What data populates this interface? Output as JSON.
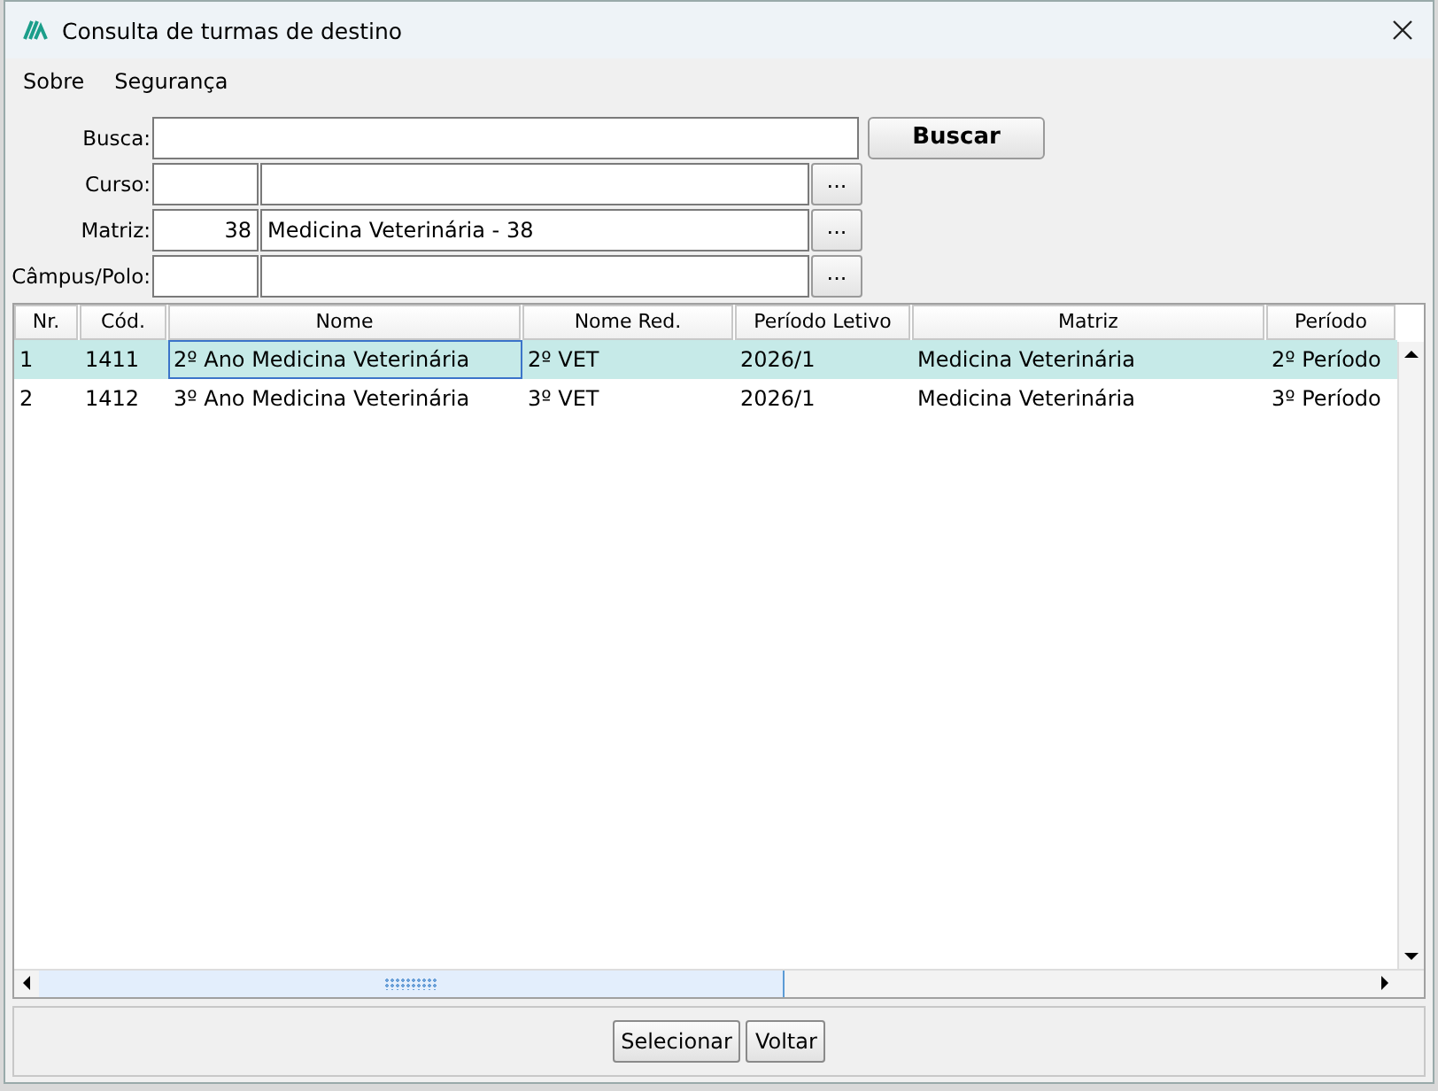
{
  "window": {
    "title": "Consulta de turmas de destino"
  },
  "menu": [
    "Sobre",
    "Segurança"
  ],
  "form": {
    "busca": {
      "label": "Busca:"
    },
    "search_button": "Buscar",
    "lookups": [
      {
        "label": "Curso:",
        "button": "..."
      },
      {
        "label": "Matriz:",
        "code": "38",
        "description": "Medicina Veterinária - 38",
        "button": "..."
      },
      {
        "label": "Câmpus/Polo:",
        "button": "..."
      }
    ]
  },
  "table": {
    "columns": [
      "Nr.",
      "Cód.",
      "Nome",
      "Nome Red.",
      "Período Letivo",
      "Matriz",
      "Período"
    ],
    "rows": [
      {
        "selected": true,
        "cells": [
          "1",
          "1411",
          "2º Ano Medicina Veterinária",
          "2º VET",
          "2026/1",
          "Medicina Veterinária",
          "2º Período"
        ]
      },
      {
        "selected": false,
        "cells": [
          "2",
          "1412",
          "3º Ano Medicina Veterinária",
          "3º VET",
          "2026/1",
          "Medicina Veterinária",
          "3º Período"
        ]
      }
    ]
  },
  "buttons": [
    "Selecionar",
    "Voltar"
  ]
}
